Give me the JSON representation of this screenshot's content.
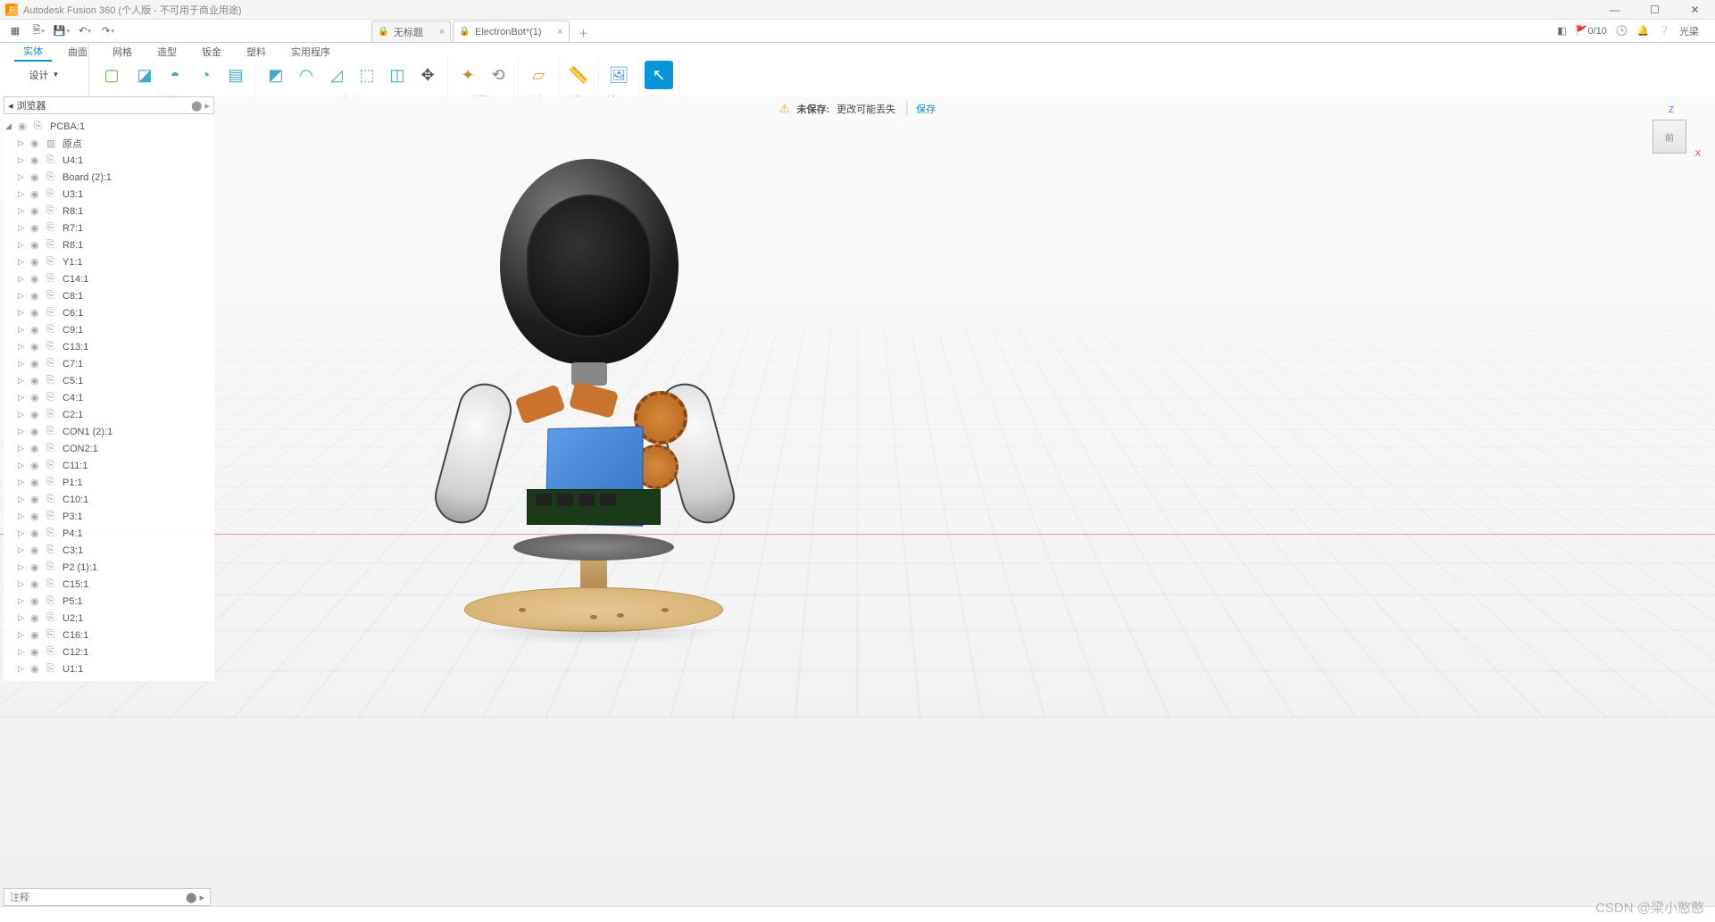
{
  "app": {
    "title": "Autodesk Fusion 360 (个人版 - 不可用于商业用途)"
  },
  "window_controls": {
    "min": "—",
    "max": "☐",
    "close": "✕"
  },
  "tabs": [
    {
      "label": "无标题",
      "active": false
    },
    {
      "label": "ElectronBot*(1)",
      "active": true
    }
  ],
  "qat_right": {
    "upload": "0/10",
    "user": "光梁"
  },
  "ribbon": {
    "design_label": "设计",
    "tabs": [
      "实体",
      "曲面",
      "网格",
      "造型",
      "钣金",
      "塑料",
      "实用程序"
    ],
    "active_tab": 0,
    "groups": {
      "create": "创建",
      "modify": "修改",
      "assemble": "装配",
      "construct": "构造",
      "inspect": "检验",
      "insert": "插入",
      "select": "选择"
    }
  },
  "browser": {
    "title": "浏览器",
    "root": "PCBA:1",
    "items": [
      "原点",
      "U4:1",
      "Board (2):1",
      "U3:1",
      "R8:1",
      "R7:1",
      "R8:1",
      "Y1:1",
      "C14:1",
      "C8:1",
      "C6:1",
      "C9:1",
      "C13:1",
      "C7:1",
      "C5:1",
      "C4:1",
      "C2:1",
      "CON1 (2):1",
      "CON2:1",
      "C11:1",
      "P1:1",
      "C10:1",
      "P3:1",
      "P4:1",
      "C3:1",
      "P2 (1):1",
      "C15:1",
      "P5:1",
      "U2:1",
      "C16:1",
      "C12:1",
      "U1:1"
    ]
  },
  "save_notice": {
    "bold": "未保存:",
    "text": "更改可能丢失",
    "link": "保存"
  },
  "viewcube": {
    "face": "前",
    "z": "Z",
    "x": "X"
  },
  "comment_bar": {
    "label": "注释"
  },
  "watermark": "CSDN @梁小憨憨"
}
